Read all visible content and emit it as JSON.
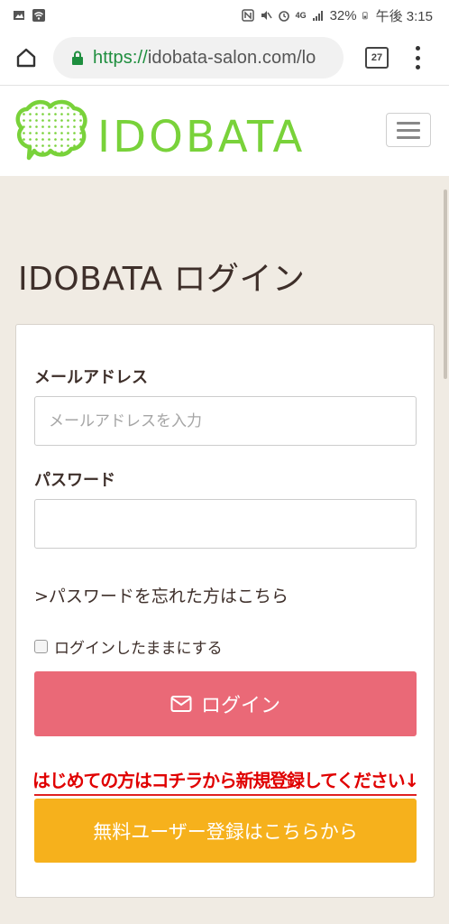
{
  "status_bar": {
    "battery": "32%",
    "time": "午後 3:15",
    "network": "4G"
  },
  "browser": {
    "url_scheme": "https://",
    "url_rest": "idobata-salon.com/lo",
    "tab_count": "27"
  },
  "header": {
    "logo_text": "IDOBATA",
    "brand_color": "#79d23a"
  },
  "page": {
    "title": "IDOBATA ログイン"
  },
  "form": {
    "email_label": "メールアドレス",
    "email_placeholder": "メールアドレスを入力",
    "password_label": "パスワード",
    "password_placeholder": "",
    "forgot_link": ">パスワードを忘れた方はこちら",
    "remember_label": "ログインしたままにする",
    "login_button": "ログイン",
    "login_color": "#ea6977",
    "promo_text": "はじめての方はコチラから新規登録してください↓",
    "register_button": "無料ユーザー登録はこちらから",
    "register_color": "#f6b11c"
  }
}
